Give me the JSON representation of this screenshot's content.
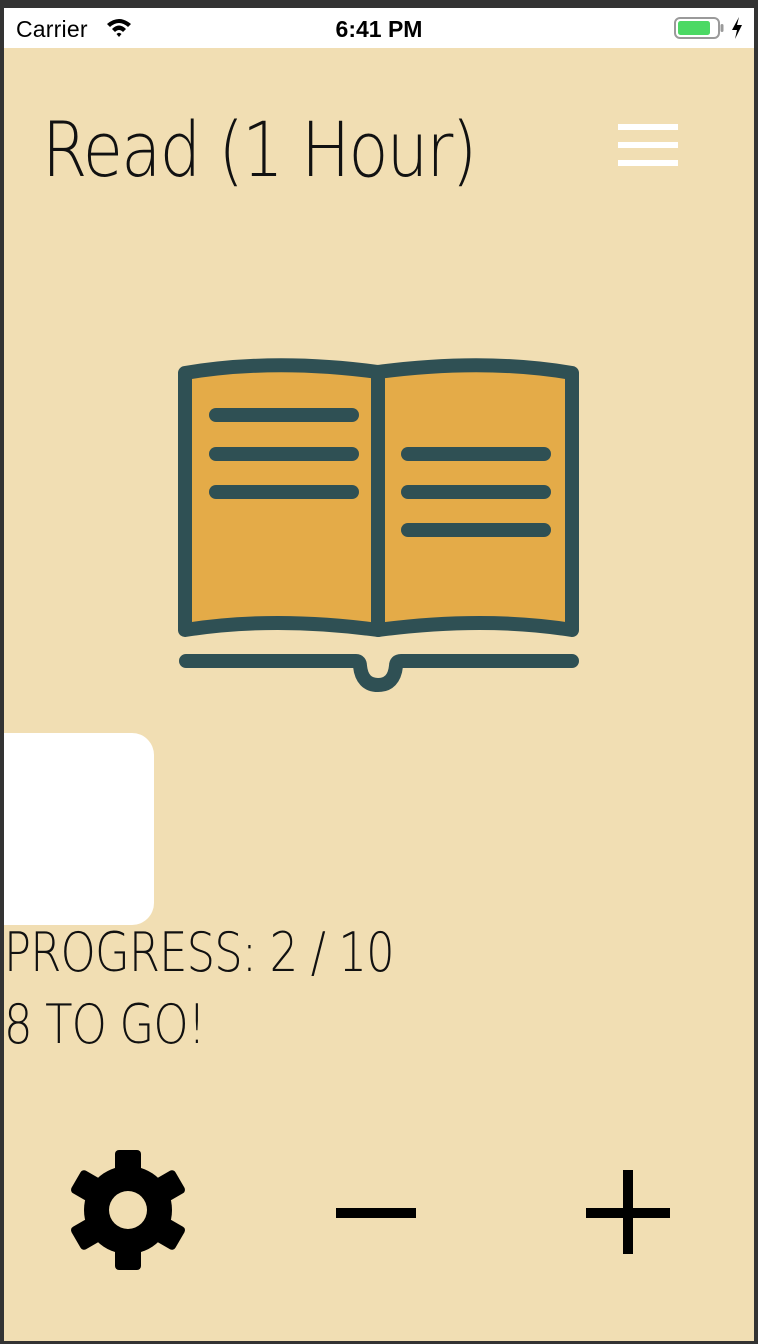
{
  "status_bar": {
    "carrier": "Carrier",
    "time": "6:41 PM",
    "battery_color": "#4CD964"
  },
  "header": {
    "title": "Read (1 Hour)",
    "menu_icon": "hamburger-menu-icon"
  },
  "hero": {
    "icon": "open-book-icon",
    "colors": {
      "outline": "#2F5054",
      "pages": "#E4AB48"
    }
  },
  "progress": {
    "label": "PROGRESS: 2 / 10",
    "remaining_label": "8 TO GO!",
    "current": 2,
    "goal": 10
  },
  "toolbar": {
    "settings_icon": "gear-icon",
    "minus_icon": "minus-icon",
    "plus_icon": "plus-icon"
  },
  "colors": {
    "background": "#F1DEB3",
    "text": "#111111"
  }
}
